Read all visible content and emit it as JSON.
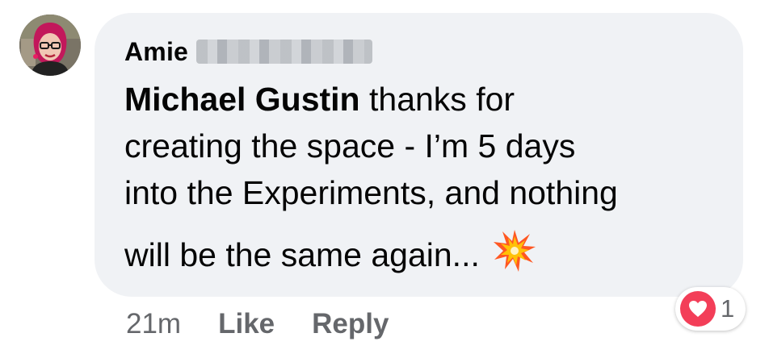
{
  "comment": {
    "author_name": "Amie",
    "mention": "Michael Gustin",
    "text_lines": [
      " thanks for",
      "creating the space - I’m 5 days",
      "into the Experiments, and nothing",
      "will be the same again..."
    ],
    "emoji_icon": "collision-icon"
  },
  "actions": {
    "timestamp": "21m",
    "like_label": "Like",
    "reply_label": "Reply"
  },
  "reaction": {
    "icon": "love-heart-icon",
    "count": "1",
    "color": "#f33e58"
  },
  "colors": {
    "bubble": "#f0f2f5",
    "text": "#050505",
    "secondary": "#65676b"
  }
}
